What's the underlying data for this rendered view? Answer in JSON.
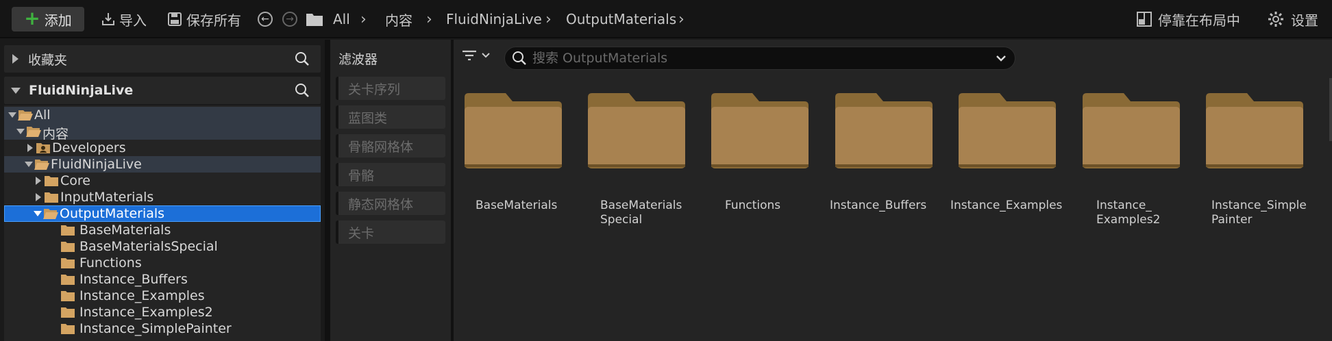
{
  "toolbar": {
    "add_label": "添加",
    "import_label": "导入",
    "save_all_label": "保存所有",
    "breadcrumb": [
      "All",
      "内容",
      "FluidNinjaLive",
      "OutputMaterials"
    ],
    "dock_label": "停靠在布局中",
    "settings_label": "设置"
  },
  "favorites": {
    "title": "收藏夹"
  },
  "source_panel": {
    "title": "FluidNinjaLive"
  },
  "tree": {
    "all": "All",
    "content": "内容",
    "developers": "Developers",
    "fluidninjalive": "FluidNinjaLive",
    "core": "Core",
    "inputmaterials": "InputMaterials",
    "outputmaterials": "OutputMaterials",
    "children": [
      "BaseMaterials",
      "BaseMaterialsSpecial",
      "Functions",
      "Instance_Buffers",
      "Instance_Examples",
      "Instance_Examples2",
      "Instance_SimplePainter"
    ]
  },
  "filters": {
    "title": "滤波器",
    "items": [
      "关卡序列",
      "蓝图类",
      "骨骼网格体",
      "骨骼",
      "静态网格体",
      "关卡"
    ]
  },
  "search": {
    "placeholder": "搜索 OutputMaterials"
  },
  "tiles": [
    {
      "l1": "BaseMaterials",
      "l2": ""
    },
    {
      "l1": "BaseMaterials",
      "l2": "Special"
    },
    {
      "l1": "Functions",
      "l2": ""
    },
    {
      "l1": "Instance_Buffers",
      "l2": ""
    },
    {
      "l1": "Instance_Examples",
      "l2": ""
    },
    {
      "l1": "Instance_",
      "l2": "Examples2"
    },
    {
      "l1": "Instance_Simple",
      "l2": "Painter"
    }
  ],
  "colors": {
    "selection": "#1c6fd8",
    "folder": "#b08a4a",
    "add_plus": "#3fb23f"
  },
  "icons": [
    "plus-icon",
    "import-icon",
    "save-icon",
    "back-icon",
    "forward-icon",
    "folder-icon",
    "chevron-right-icon",
    "layout-icon",
    "gear-icon",
    "search-icon",
    "filter-icon",
    "chevron-down-icon"
  ]
}
